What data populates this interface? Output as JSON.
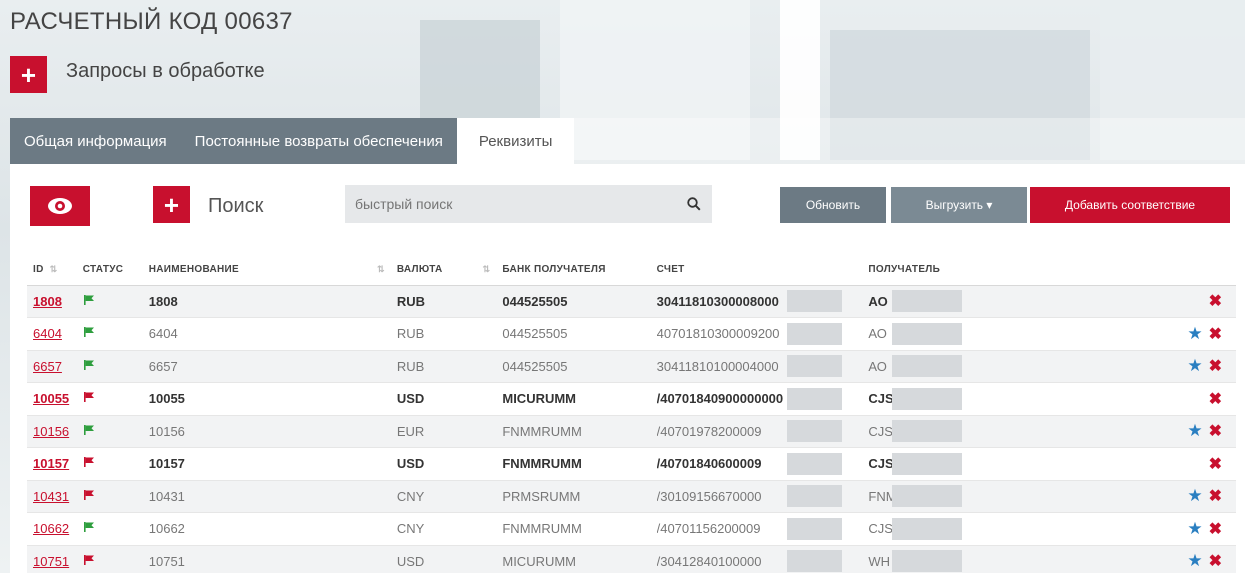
{
  "header": {
    "title": "РАСЧЕТНЫЙ КОД 00637",
    "subtitle": "Запросы в обработке",
    "plus_symbol": "+"
  },
  "tabs": [
    {
      "label": "Общая информация",
      "active": false
    },
    {
      "label": "Постоянные возвраты обеспечения",
      "active": false
    },
    {
      "label": "Реквизиты",
      "active": true
    }
  ],
  "toolbar": {
    "search_label": "Поиск",
    "search_placeholder": "быстрый поиск",
    "refresh_label": "Обновить",
    "export_label": "Выгрузить ▾",
    "add_label": "Добавить соответствие"
  },
  "colors": {
    "accent": "#c8102e",
    "tab_bg": "#6c7a84",
    "flag_green": "#2e9e3e",
    "flag_red": "#c8102e",
    "star": "#2a7fc1"
  },
  "table": {
    "columns": [
      "ID",
      "СТАТУС",
      "НАИМЕНОВАНИЕ",
      "ВАЛЮТА",
      "БАНК ПОЛУЧАТЕЛЯ",
      "СЧЕТ",
      "ПОЛУЧАТЕЛЬ"
    ],
    "rows": [
      {
        "id": "1808",
        "status": "green",
        "name": "1808",
        "currency": "RUB",
        "bank": "044525505",
        "account": "30411810300008000",
        "recipient": "АО",
        "bold": true,
        "star": false
      },
      {
        "id": "6404",
        "status": "green",
        "name": "6404",
        "currency": "RUB",
        "bank": "044525505",
        "account": "40701810300009200",
        "recipient": "АО",
        "bold": false,
        "star": true
      },
      {
        "id": "6657",
        "status": "green",
        "name": "6657",
        "currency": "RUB",
        "bank": "044525505",
        "account": "30411810100004000",
        "recipient": "АО",
        "bold": false,
        "star": true
      },
      {
        "id": "10055",
        "status": "red",
        "name": "10055",
        "currency": "USD",
        "bank": "MICURUMM",
        "account": "/40701840900000000",
        "recipient": "CJS(",
        "bold": true,
        "star": false
      },
      {
        "id": "10156",
        "status": "green",
        "name": "10156",
        "currency": "EUR",
        "bank": "FNMMRUMM",
        "account": "/40701978200009",
        "recipient": "CJS(",
        "bold": false,
        "star": true
      },
      {
        "id": "10157",
        "status": "red",
        "name": "10157",
        "currency": "USD",
        "bank": "FNMMRUMM",
        "account": "/40701840600009",
        "recipient": "CJS(",
        "bold": true,
        "star": false
      },
      {
        "id": "10431",
        "status": "red",
        "name": "10431",
        "currency": "CNY",
        "bank": "PRMSRUMM",
        "account": "/30109156670000",
        "recipient": "FNM",
        "bold": false,
        "star": true
      },
      {
        "id": "10662",
        "status": "green",
        "name": "10662",
        "currency": "CNY",
        "bank": "FNMMRUMM",
        "account": "/40701156200009",
        "recipient": "CJS(",
        "bold": false,
        "star": true
      },
      {
        "id": "10751",
        "status": "red",
        "name": "10751",
        "currency": "USD",
        "bank": "MICURUMM",
        "account": "/30412840100000",
        "recipient": "WH",
        "bold": false,
        "star": true
      }
    ]
  }
}
